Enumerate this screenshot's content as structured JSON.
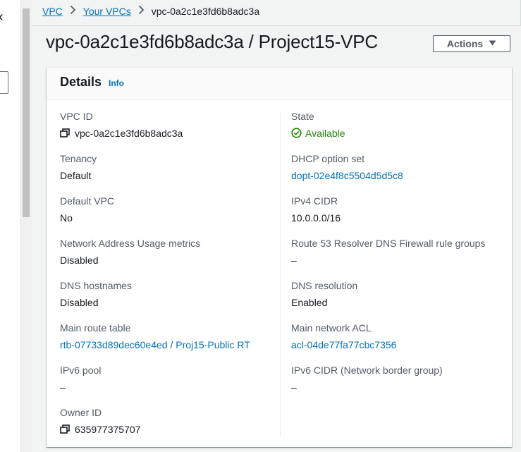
{
  "breadcrumb": {
    "items": [
      "VPC",
      "Your VPCs"
    ],
    "current": "vpc-0a2c1e3fd6b8adc3a"
  },
  "page": {
    "title": "vpc-0a2c1e3fd6b8adc3a / Project15-VPC",
    "actions_label": "Actions"
  },
  "details": {
    "title": "Details",
    "info_label": "Info",
    "left": [
      {
        "label": "VPC ID",
        "value": "vpc-0a2c1e3fd6b8adc3a"
      },
      {
        "label": "Tenancy",
        "value": "Default"
      },
      {
        "label": "Default VPC",
        "value": "No"
      },
      {
        "label": "Network Address Usage metrics",
        "value": "Disabled"
      },
      {
        "label": "DNS hostnames",
        "value": "Disabled"
      },
      {
        "label": "Main route table",
        "value": "rtb-07733d89dec60e4ed / Proj15-Public RT"
      },
      {
        "label": "IPv6 pool",
        "value": "–"
      },
      {
        "label": "Owner ID",
        "value": "635977375707"
      }
    ],
    "right": [
      {
        "label": "State",
        "value": "Available"
      },
      {
        "label": "DHCP option set",
        "value": "dopt-02e4f8c5504d5d5c8"
      },
      {
        "label": "IPv4 CIDR",
        "value": "10.0.0.0/16"
      },
      {
        "label": "Route 53 Resolver DNS Firewall rule groups",
        "value": "–"
      },
      {
        "label": "DNS resolution",
        "value": "Enabled"
      },
      {
        "label": "Main network ACL",
        "value": "acl-04de77fa77cbc7356"
      },
      {
        "label": "IPv6 CIDR (Network border group)",
        "value": "–"
      }
    ]
  },
  "colors": {
    "link": "#0073bb",
    "success": "#1d8102",
    "text": "#16191f",
    "muted": "#545b64"
  },
  "icons": {
    "copy": "copy-icon",
    "status_ok": "check-circle-icon",
    "breadcrumb_separator": "chevron-right-icon",
    "actions_caret": "caret-down-icon"
  }
}
